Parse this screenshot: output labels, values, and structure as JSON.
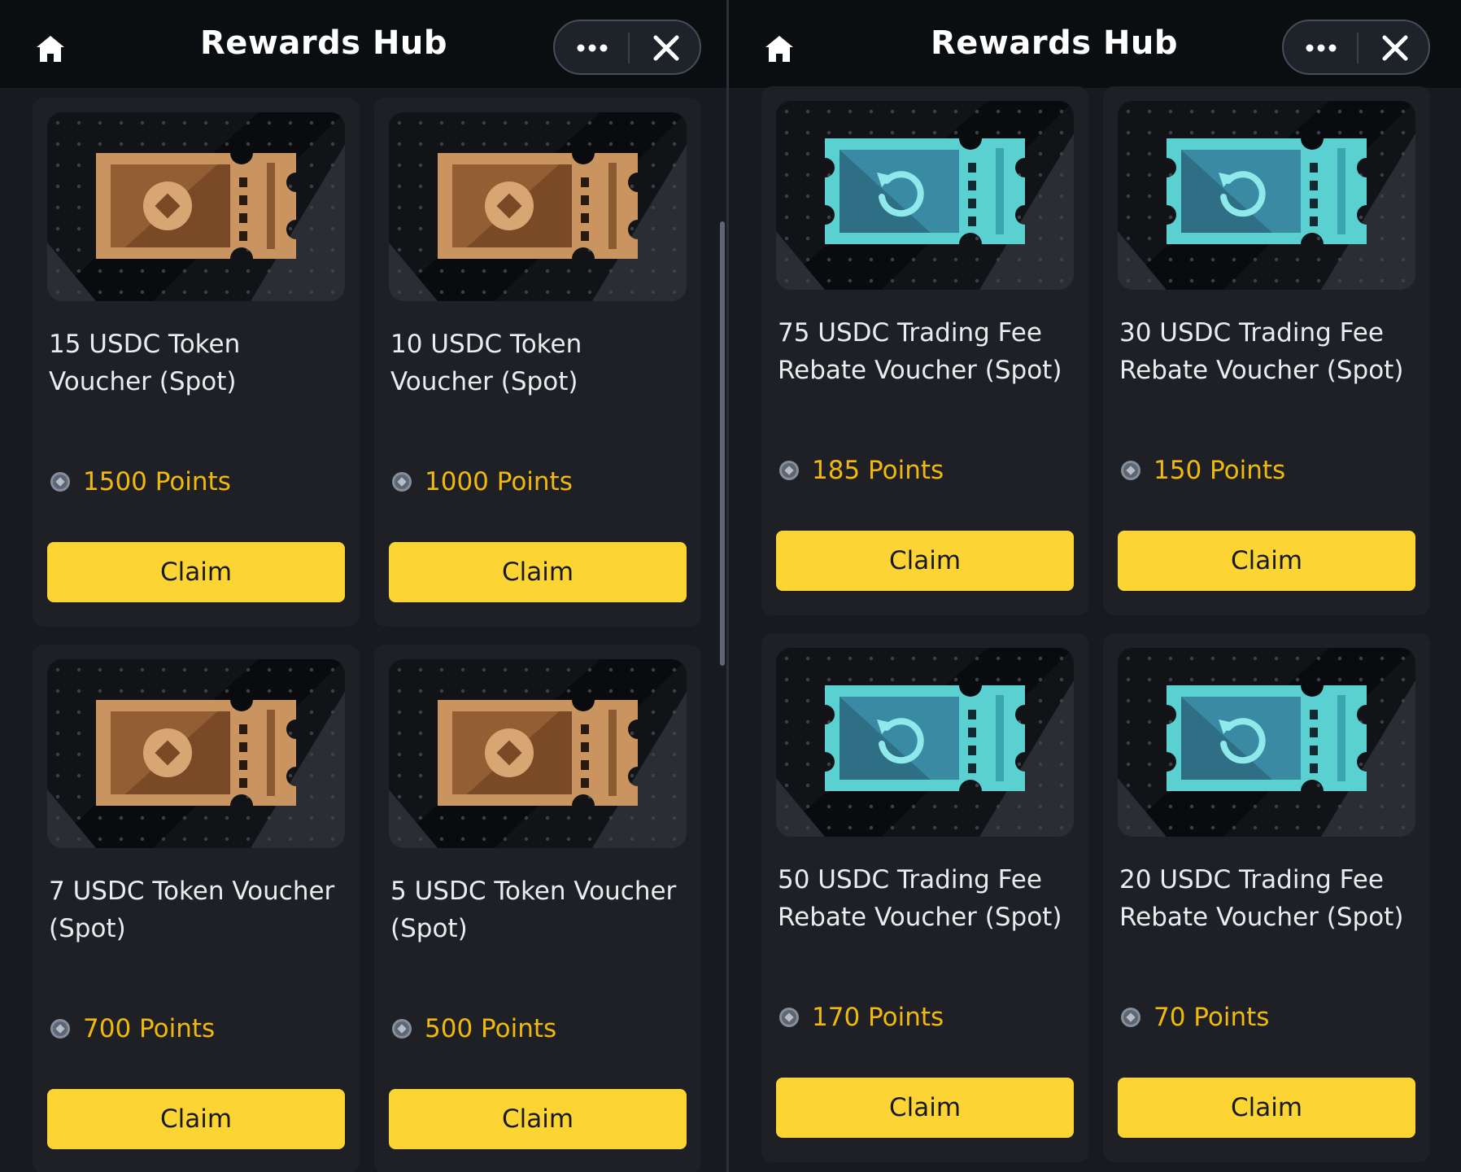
{
  "left": {
    "header": {
      "title": "Rewards Hub"
    },
    "cards": [
      {
        "title": "15 USDC Token Voucher (Spot)",
        "points": "1500 Points",
        "claim": "Claim"
      },
      {
        "title": "10 USDC Token Voucher (Spot)",
        "points": "1000 Points",
        "claim": "Claim"
      },
      {
        "title": "7 USDC Token Voucher (Spot)",
        "points": "700 Points",
        "claim": "Claim"
      },
      {
        "title": "5 USDC Token Voucher (Spot)",
        "points": "500 Points",
        "claim": "Claim"
      }
    ]
  },
  "right": {
    "header": {
      "title": "Rewards Hub"
    },
    "cards": [
      {
        "title": "75 USDC Trading Fee Rebate Voucher (Spot)",
        "points": "185 Points",
        "claim": "Claim"
      },
      {
        "title": "30 USDC Trading Fee Rebate Voucher (Spot)",
        "points": "150 Points",
        "claim": "Claim"
      },
      {
        "title": "50 USDC Trading Fee Rebate Voucher (Spot)",
        "points": "170 Points",
        "claim": "Claim"
      },
      {
        "title": "20 USDC Trading Fee Rebate Voucher (Spot)",
        "points": "70 Points",
        "claim": "Claim"
      }
    ]
  },
  "icons": {
    "home": "home-icon",
    "more": "more-icon",
    "close": "close-icon",
    "coin": "points-coin-icon",
    "token_voucher": "token-voucher-icon",
    "rebate_voucher": "rebate-voucher-icon"
  },
  "colors": {
    "background": "#181a20",
    "card": "#1e2026",
    "accent": "#fcd535",
    "points_text": "#f0b90b",
    "token_voucher": "#c99462",
    "rebate_voucher": "#5fd3d3"
  }
}
